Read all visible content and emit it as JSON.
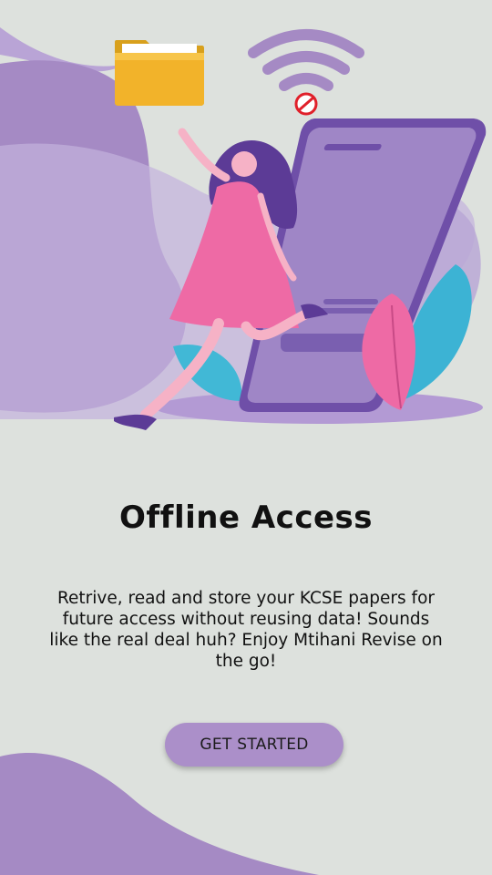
{
  "onboarding": {
    "title": "Offline Access",
    "description": "Retrive, read and store your KCSE papers for future access without reusing data! Sounds like the real deal huh? Enjoy Mtihani Revise on the go!",
    "cta_label": "GET STARTED"
  },
  "icons": {
    "folder": "folder-icon",
    "wifi": "wifi-icon",
    "no_signal": "no-entry-icon"
  },
  "colors": {
    "background": "#dde1dd",
    "accent_purple": "#a58ac4",
    "button": "#ab8fc9",
    "dress_pink": "#ee6aa5",
    "leaf_blue": "#3fb6d6"
  }
}
